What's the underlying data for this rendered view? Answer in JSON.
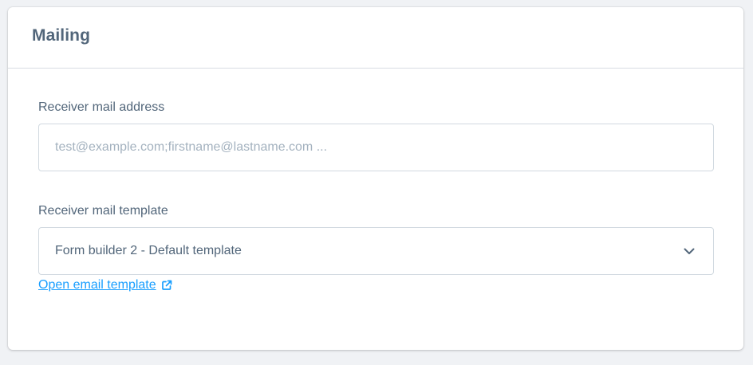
{
  "card": {
    "title": "Mailing"
  },
  "receiver_address": {
    "label": "Receiver mail address",
    "value": "",
    "placeholder": "test@example.com;firstname@lastname.com ..."
  },
  "receiver_template": {
    "label": "Receiver mail template",
    "selected": "Form builder 2 - Default template"
  },
  "template_link": {
    "label": "Open email template",
    "icon": "external-link-icon"
  },
  "colors": {
    "text": "#52667a",
    "placeholder": "#a4b2bf",
    "link": "#189eff",
    "border": "#d1d9e0"
  }
}
